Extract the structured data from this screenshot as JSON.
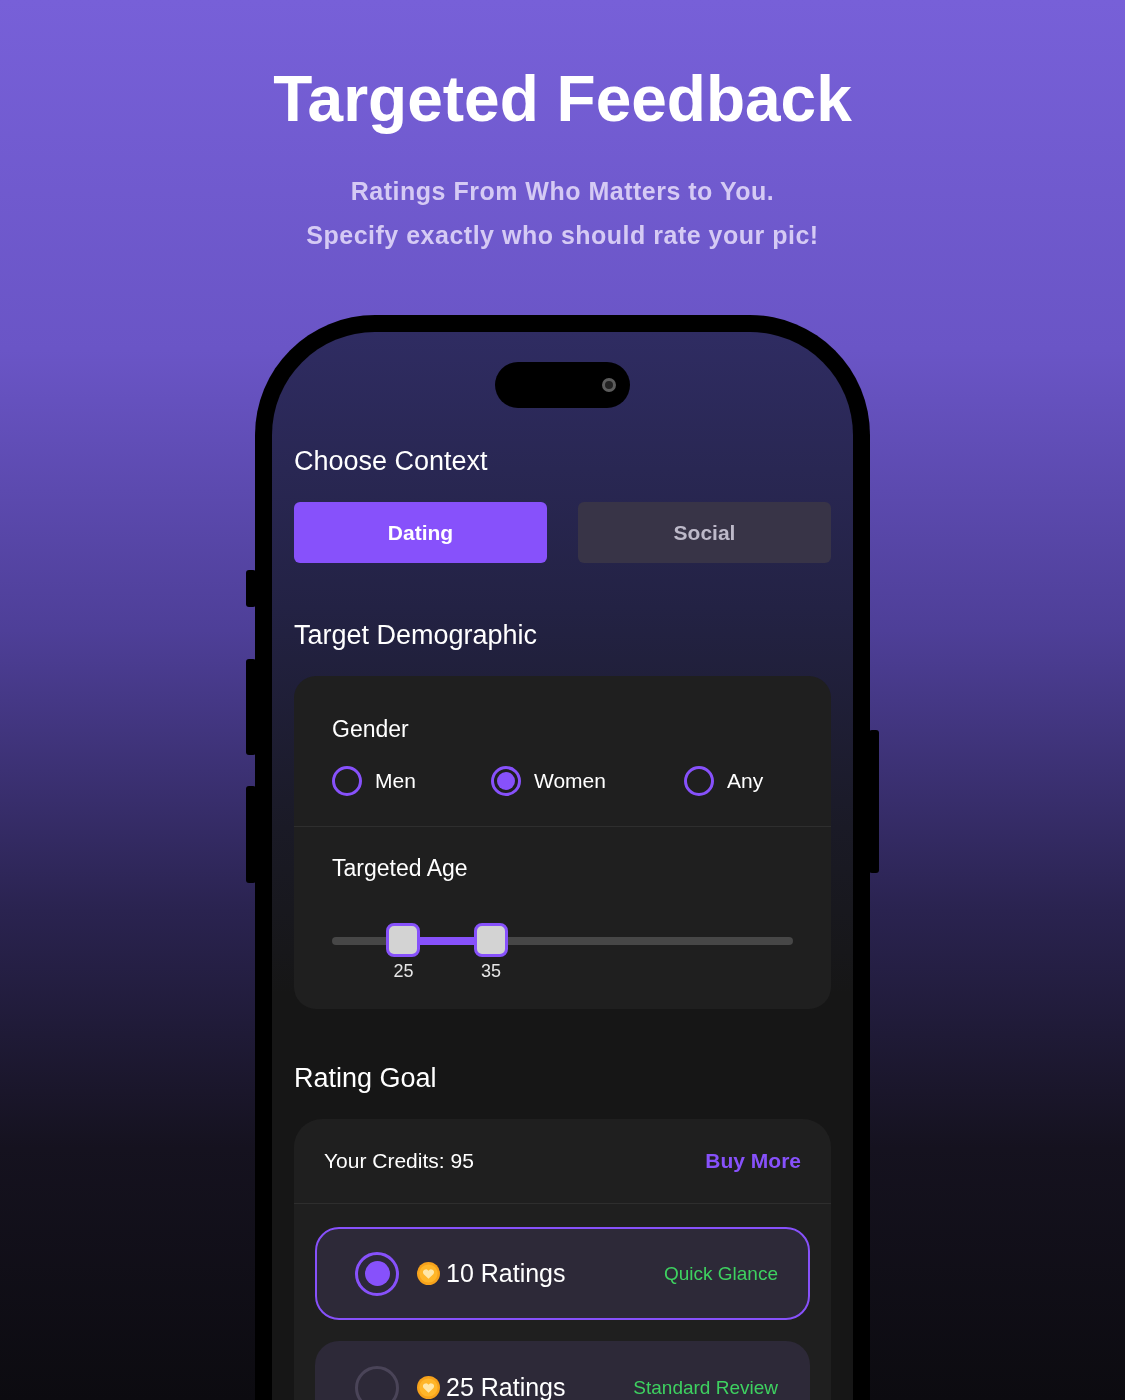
{
  "title": "Targeted Feedback",
  "subtitle": [
    "Ratings From Who Matters to You.",
    "Specify exactly who should rate your pic!"
  ],
  "context": {
    "heading": "Choose Context",
    "tabs": [
      {
        "label": "Dating",
        "selected": true
      },
      {
        "label": "Social",
        "selected": false
      }
    ]
  },
  "demographic": {
    "heading": "Target Demographic",
    "gender": {
      "label": "Gender",
      "options": [
        {
          "label": "Men",
          "selected": false
        },
        {
          "label": "Women",
          "selected": true
        },
        {
          "label": "Any",
          "selected": false
        }
      ]
    },
    "age": {
      "label": "Targeted Age",
      "thumbs": [
        {
          "level": 0.155,
          "reading": "25"
        },
        {
          "level": 0.345,
          "reading": "35"
        }
      ]
    }
  },
  "rating_goal": {
    "heading": "Rating Goal",
    "credits": "Your Credits: 95",
    "buy_link": "Buy More",
    "options": [
      {
        "label": "10 Ratings",
        "tag": "Quick Glance",
        "selected": true
      },
      {
        "label": "25 Ratings",
        "tag": "Standard Review",
        "selected": false
      }
    ]
  }
}
